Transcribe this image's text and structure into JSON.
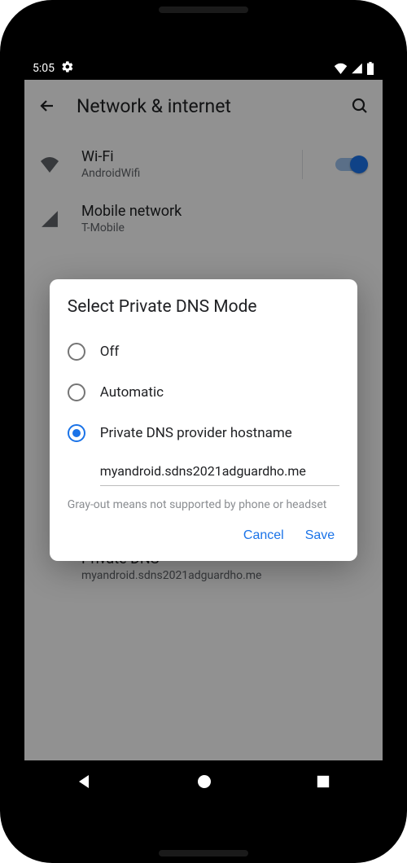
{
  "status": {
    "time": "5:05"
  },
  "appbar": {
    "title": "Network & internet"
  },
  "rows": {
    "wifi": {
      "title": "Wi-Fi",
      "sub": "AndroidWifi"
    },
    "mobile": {
      "title": "Mobile network",
      "sub": "T-Mobile"
    },
    "private": {
      "title": "Private DNS",
      "sub": "myandroid.sdns2021adguardho.me"
    }
  },
  "dialog": {
    "title": "Select Private DNS Mode",
    "options": {
      "off": "Off",
      "auto": "Automatic",
      "host": "Private DNS provider hostname"
    },
    "hostname_value": "myandroid.sdns2021adguardho.me",
    "helper": "Gray-out means not supported by phone or headset",
    "cancel": "Cancel",
    "save": "Save"
  }
}
